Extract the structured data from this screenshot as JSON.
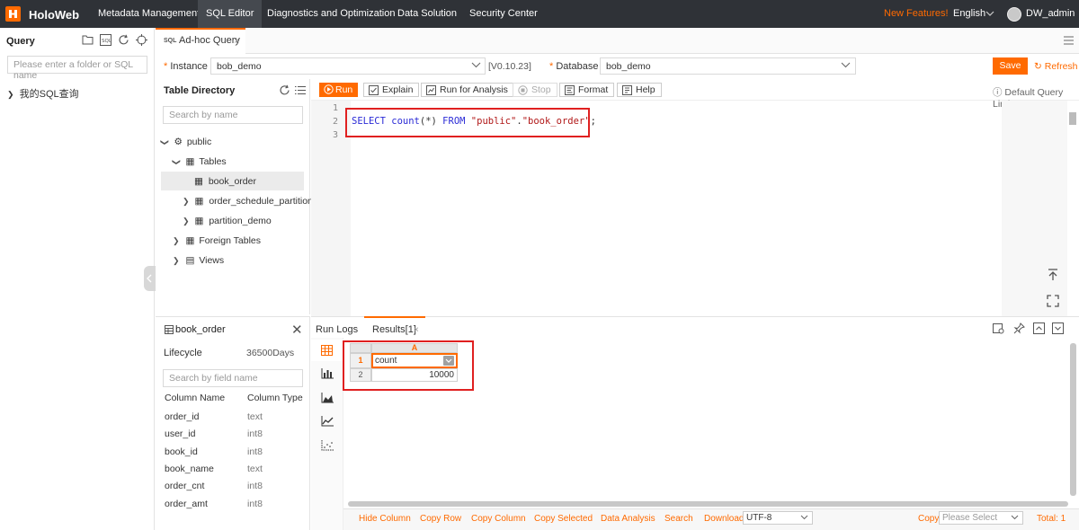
{
  "brand": "HoloWeb",
  "nav": {
    "items": [
      "Metadata Management",
      "SQL Editor",
      "Diagnostics and Optimization",
      "Data Solution",
      "Security Center"
    ],
    "new_features": "New Features!",
    "language": "English",
    "user": "DW_admin"
  },
  "query_panel": {
    "title": "Query",
    "search_placeholder": "Please enter a folder or SQL name",
    "my_sql": "我的SQL查询"
  },
  "tab": {
    "icon": "SQL",
    "label": "Ad-hoc Query",
    "close": "×"
  },
  "instance": {
    "label": "Instance",
    "required": "*",
    "value": "bob_demo",
    "version": "[V0.10.23]",
    "database_label": "Database",
    "database_value": "bob_demo",
    "save": "Save",
    "refresh": "Refresh"
  },
  "directory": {
    "title": "Table Directory",
    "search_placeholder": "Search by name",
    "schema": "public",
    "tables": "Tables",
    "table_items": [
      "book_order",
      "order_schedule_partition",
      "partition_demo"
    ],
    "foreign_tables": "Foreign Tables",
    "views": "Views"
  },
  "toolbar": {
    "run": "Run",
    "explain": "Explain",
    "run_for_analysis": "Run for Analysis",
    "stop": "Stop",
    "format": "Format",
    "help": "Help",
    "default_limit": "Default Query Limit"
  },
  "editor": {
    "line_numbers": [
      "1",
      "2",
      "3"
    ],
    "sql": {
      "select": "SELECT",
      "fn": "count",
      "args": "(*)",
      "from": "FROM",
      "schema": "\"public\"",
      "dot": ".",
      "table": "\"book_order\"",
      "end": ";"
    }
  },
  "details": {
    "table": "book_order",
    "lifecycle_label": "Lifecycle",
    "lifecycle_value": "36500Days",
    "field_search_placeholder": "Search by field name",
    "col_name_header": "Column Name",
    "col_type_header": "Column Type",
    "columns": [
      {
        "name": "order_id",
        "type": "text"
      },
      {
        "name": "user_id",
        "type": "int8"
      },
      {
        "name": "book_id",
        "type": "int8"
      },
      {
        "name": "book_name",
        "type": "text"
      },
      {
        "name": "order_cnt",
        "type": "int8"
      },
      {
        "name": "order_amt",
        "type": "int8"
      }
    ]
  },
  "results": {
    "tab_run_logs": "Run Logs",
    "tab_results": "Results[1]",
    "column_letter": "A",
    "row_numbers": [
      "1",
      "2"
    ],
    "header_value": "count",
    "cell_value": "10000"
  },
  "footer": {
    "hide_column": "Hide Column",
    "copy_row": "Copy Row",
    "copy_column": "Copy Column",
    "copy_selected": "Copy Selected",
    "data_analysis": "Data Analysis",
    "search": "Search",
    "download": "Download",
    "encoding": "UTF-8",
    "copy": "Copy",
    "copy_placeholder": "Please Select",
    "total": "Total: 1"
  },
  "colors": {
    "accent": "#ff6a00",
    "nav_bg": "#2f3237",
    "highlight": "#e02020"
  }
}
